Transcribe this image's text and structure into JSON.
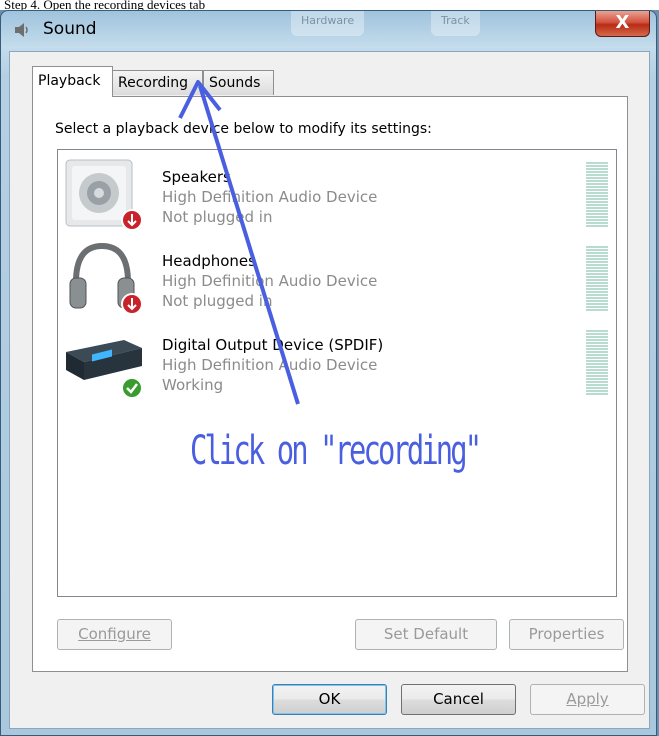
{
  "window": {
    "title": "Sound",
    "close_glyph": "X",
    "ghost_tabs": [
      "Hardware",
      "Track"
    ]
  },
  "caption": "Step 4. Open the recording devices tab",
  "tabs": [
    {
      "label": "Playback",
      "active": true
    },
    {
      "label": "Recording",
      "active": false
    },
    {
      "label": "Sounds",
      "active": false
    }
  ],
  "panel": {
    "instruction": "Select a playback device below to modify its settings:"
  },
  "devices": [
    {
      "name": "Speakers",
      "subtitle": "High Definition Audio Device",
      "status": "Not plugged in",
      "icon": "speaker-icon",
      "badge": "unplugged-badge"
    },
    {
      "name": "Headphones",
      "subtitle": "High Definition Audio Device",
      "status": "Not plugged in",
      "icon": "headphones-icon",
      "badge": "unplugged-badge"
    },
    {
      "name": "Digital Output Device (SPDIF)",
      "subtitle": "High Definition Audio Device",
      "status": "Working",
      "icon": "digital-output-icon",
      "badge": "working-badge"
    }
  ],
  "panel_buttons": {
    "configure": {
      "label": "Configure",
      "mnemonic": "C",
      "disabled": true
    },
    "set_default": {
      "label": "Set Default",
      "mnemonic": "S",
      "disabled": true
    },
    "properties": {
      "label": "Properties",
      "mnemonic": "P",
      "disabled": true
    }
  },
  "dialog_buttons": {
    "ok": "OK",
    "cancel": "Cancel",
    "apply": {
      "label": "Apply",
      "mnemonic": "A",
      "disabled": true
    }
  },
  "annotation": {
    "text": "Click on \"recording\"",
    "color": "#4a5fe0"
  },
  "colors": {
    "accent": "#4a5fe0",
    "disabled_text": "#9a9a9a",
    "secondary_text": "#8b8b8b",
    "close": "#c8432d"
  }
}
